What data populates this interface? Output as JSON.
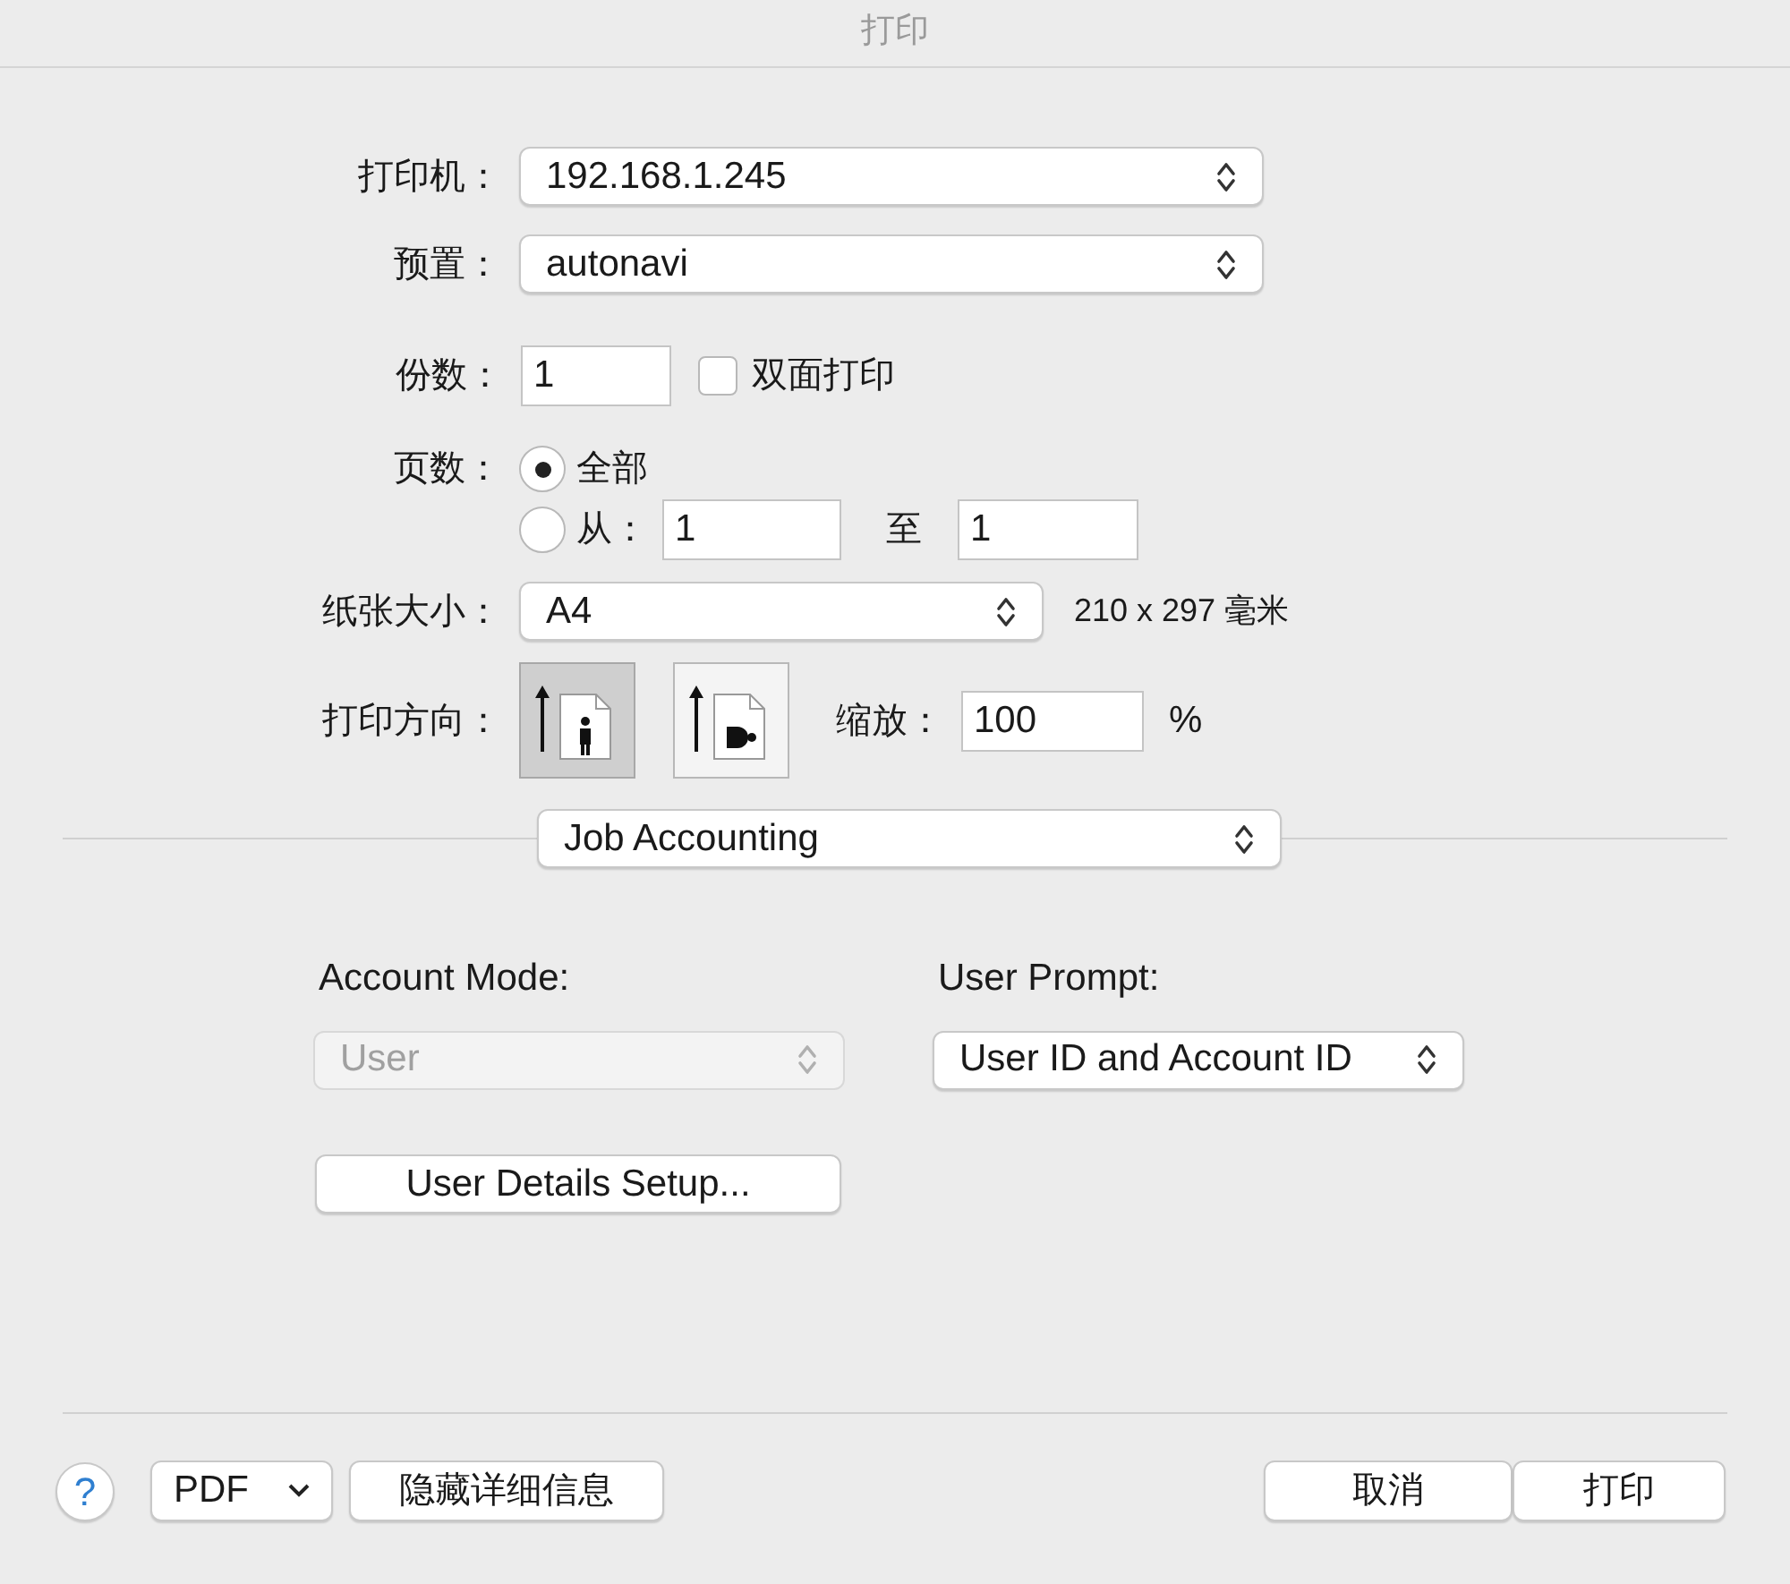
{
  "window": {
    "title": "打印"
  },
  "printer": {
    "label": "打印机：",
    "value": "192.168.1.245"
  },
  "preset": {
    "label": "预置：",
    "value": "autonavi"
  },
  "copies": {
    "label": "份数：",
    "value": "1",
    "duplex": {
      "label": "双面打印",
      "checked": false
    }
  },
  "pages": {
    "label": "页数：",
    "options": [
      {
        "label": "全部",
        "selected": true
      },
      {
        "label": "从：",
        "selected": false
      }
    ],
    "from": "1",
    "to_label": "至",
    "to": "1"
  },
  "paper_size": {
    "label": "纸张大小：",
    "value": "A4",
    "dimensions": "210 x 297 毫米"
  },
  "orientation": {
    "label": "打印方向：",
    "options": [
      {
        "kind": "portrait",
        "selected": true
      },
      {
        "kind": "landscape",
        "selected": false
      }
    ],
    "scale_label": "缩放：",
    "scale": "100",
    "scale_unit": "%"
  },
  "section_popup": "Job Accounting",
  "account_mode": {
    "label": "Account Mode:",
    "value": "User",
    "disabled": true
  },
  "user_prompt": {
    "label": "User Prompt:",
    "value": "User ID and Account ID",
    "disabled": false
  },
  "details_button": "User Details Setup...",
  "footer": {
    "help": "?",
    "pdf": "PDF",
    "hide_details": "隐藏详细信息",
    "cancel": "取消",
    "print": "打印"
  }
}
